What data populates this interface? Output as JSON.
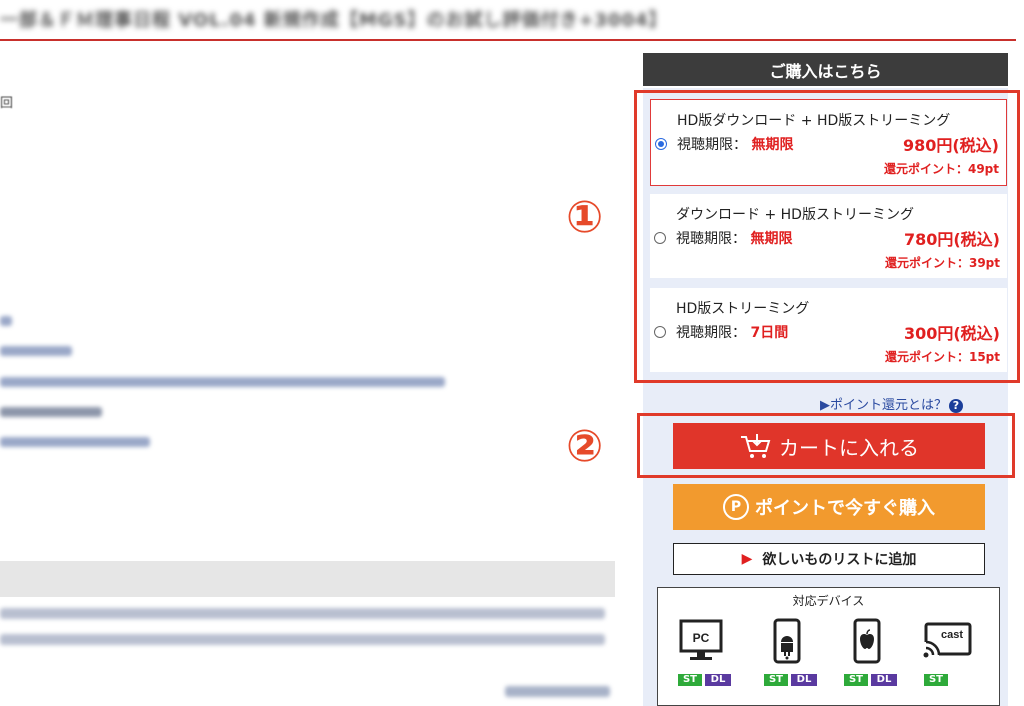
{
  "purchase": {
    "header": "ご購入はこちら",
    "options": [
      {
        "name": "HD版ダウンロード + HD版ストリーミング",
        "limit_label": "視聴期限：",
        "limit_value": "無期限",
        "price": "980円(税込)",
        "points": "還元ポイント：49pt",
        "selected": true
      },
      {
        "name": "ダウンロード + HD版ストリーミング",
        "limit_label": "視聴期限：",
        "limit_value": "無期限",
        "price": "780円(税込)",
        "points": "還元ポイント：39pt",
        "selected": false
      },
      {
        "name": "HD版ストリーミング",
        "limit_label": "視聴期限：",
        "limit_value": "7日間",
        "price": "300円(税込)",
        "points": "還元ポイント：15pt",
        "selected": false
      }
    ],
    "point_link": "▶ポイント還元とは？",
    "cart_button": "カートに入れる",
    "point_buy_button": "ポイントで今すぐ購入",
    "wishlist_button": "欲しいものリストに追加",
    "devices": {
      "title": "対応デバイス",
      "pc_label": "PC",
      "cast_label": "cast",
      "badge_st": "ST",
      "badge_dl": "DL"
    }
  },
  "annotations": {
    "one": "①",
    "two": "②"
  },
  "left": {
    "blurred_title": "一部＆ＦＭ理事日程 VOL.04 新規作成【MGS】のお試し評価付き+3004】",
    "count_suffix": "回"
  },
  "colors": {
    "accent_red": "#e0352a",
    "orange": "#f29a2e",
    "header_dark": "#3c3c3c",
    "sidebar_bg": "#e8edf8"
  }
}
